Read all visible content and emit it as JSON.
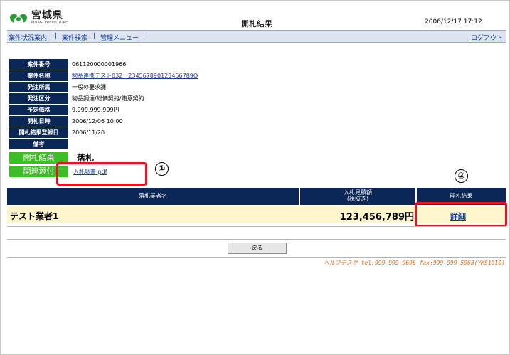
{
  "header": {
    "logo_title": "宮城県",
    "logo_sub": "MIYAGI PREFECTURE",
    "page_title": "開札結果",
    "datetime": "2006/12/17 17:12"
  },
  "nav": {
    "items": [
      "案件状況案内",
      "案件検索",
      "管理メニュー"
    ],
    "separator": "|",
    "logout": "ログアウト"
  },
  "info": {
    "rows": [
      {
        "label": "案件番号",
        "value": "061120000001966"
      },
      {
        "label": "案件名称",
        "value": "物品連携テスト032__234567890123456789O"
      },
      {
        "label": "発注所属",
        "value": "一般の要求課"
      },
      {
        "label": "発注区分",
        "value": "物品調達/総価契約/随意契約"
      },
      {
        "label": "予定価格",
        "value": "9,999,999,999円"
      },
      {
        "label": "開札日時",
        "value": "2006/12/06 10:00"
      },
      {
        "label": "開札結果登録日",
        "value": "2006/11/20"
      },
      {
        "label": "備考",
        "value": ""
      }
    ],
    "result_label": "開札結果",
    "result_value": "落札",
    "attachment_label": "関連添付",
    "attachment_file": "入札調書.pdf"
  },
  "annotations": {
    "one": "①",
    "two": "②"
  },
  "results_table": {
    "headers": {
      "bidder": "落札業者名",
      "amount_line1": "入札見積額",
      "amount_line2": "(税抜き)",
      "result": "開札結果"
    },
    "rows": [
      {
        "bidder": "テスト業者1",
        "amount": "123,456,789円",
        "detail": "詳細"
      }
    ]
  },
  "back_button": "戻る",
  "helpdesk": "ヘルプデスク tel:999-999-9696 fax:999-999-5963(YMS1010)",
  "colors": {
    "navy": "#0b2757",
    "green": "#3dbe28",
    "annotation_red": "#e8141d",
    "link_blue": "#1a3d8f",
    "row_highlight": "#fdf5cc",
    "helpdesk_orange": "#e06a10"
  }
}
